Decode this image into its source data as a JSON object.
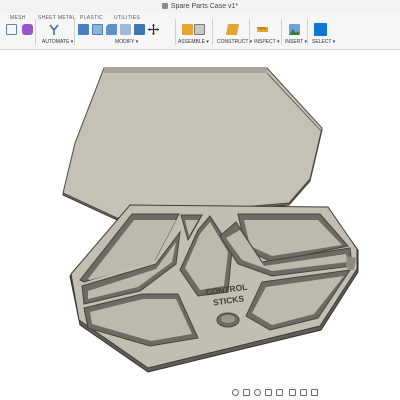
{
  "window": {
    "title": "Spare Parts Case v1*"
  },
  "ribbon": {
    "tabs": {
      "mesh": "MESH",
      "sheet_metal": "SHEET METAL",
      "plastic": "PLASTIC",
      "utilities": "UTILITIES"
    },
    "groups": {
      "automate": "AUTOMATE ▾",
      "modify": "MODIFY ▾",
      "assemble": "ASSEMBLE ▾",
      "construct": "CONSTRUCT ▾",
      "inspect": "INSPECT ▾",
      "insert": "INSERT ▾",
      "select": "SELECT ▾"
    }
  },
  "model": {
    "emboss_line1": "CONTROL",
    "emboss_line2": "STICKS"
  },
  "colors": {
    "model_face": "#c7c3b7",
    "model_edge": "#505048",
    "select_blue": "#0e77d4"
  }
}
